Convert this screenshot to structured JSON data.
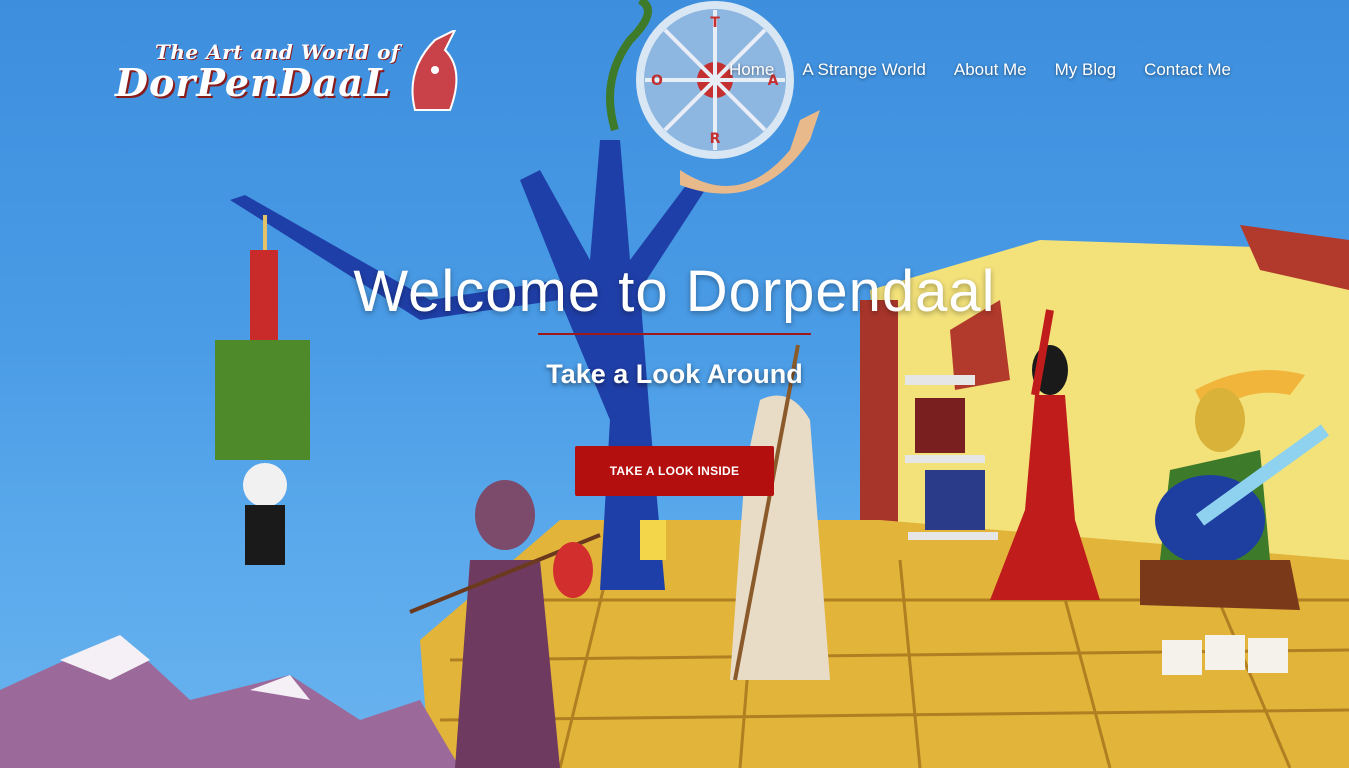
{
  "logo": {
    "line1": "The Art and World of",
    "line2": "DorPenDaaL"
  },
  "nav": {
    "items": [
      {
        "label": "Home"
      },
      {
        "label": "A Strange World"
      },
      {
        "label": "About Me"
      },
      {
        "label": "My Blog"
      },
      {
        "label": "Contact Me"
      }
    ]
  },
  "hero": {
    "title": "Welcome to Dorpendaal",
    "subtitle": "Take a Look Around",
    "cta_label": "TAKE A LOOK INSIDE"
  },
  "colors": {
    "accent": "#b30f0f",
    "sky": "#4a9ce6",
    "text": "#ffffff"
  },
  "painting": {
    "wheel_letters": [
      "T",
      "A",
      "R",
      "O"
    ]
  }
}
